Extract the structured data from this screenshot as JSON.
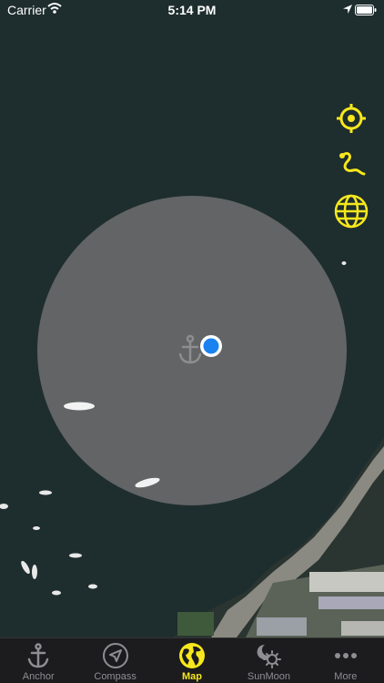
{
  "status_bar": {
    "carrier": "Carrier",
    "time": "5:14 PM"
  },
  "map": {
    "controls": [
      "crosshair-icon",
      "track-icon",
      "globe-icon"
    ],
    "anchor_icon": "anchor-icon",
    "position_marker": "current-location"
  },
  "colors": {
    "accent": "#f7e81c",
    "location": "#1a82f0",
    "tab_inactive": "#8e8e93"
  },
  "tabs": [
    {
      "label": "Anchor",
      "icon": "anchor-icon"
    },
    {
      "label": "Compass",
      "icon": "compass-icon"
    },
    {
      "label": "Map",
      "icon": "globe-icon",
      "active": true
    },
    {
      "label": "SunMoon",
      "icon": "sunmoon-icon"
    },
    {
      "label": "More",
      "icon": "more-icon"
    }
  ]
}
